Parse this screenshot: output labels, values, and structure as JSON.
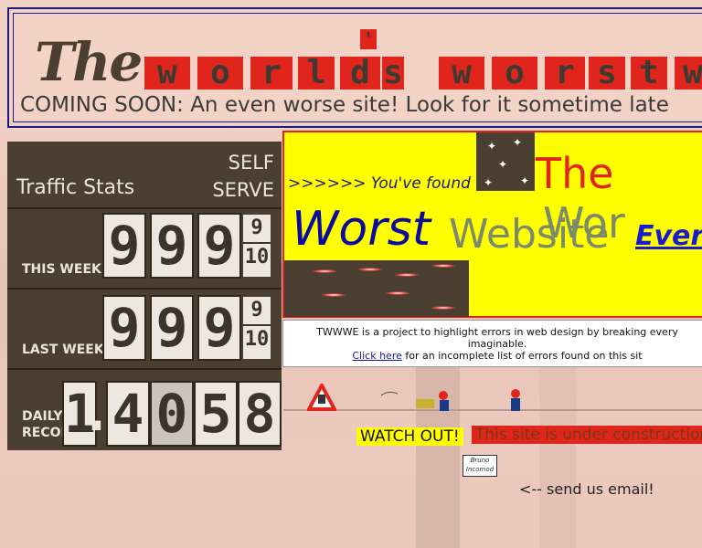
{
  "header": {
    "logo_the": "The",
    "logo_tiles": [
      "w",
      "o",
      "r",
      "l",
      "d",
      "'",
      "s",
      "w",
      "o",
      "r",
      "s",
      "t",
      "w"
    ],
    "coming_soon": "COMING SOON: An even worse site! Look for it sometime late"
  },
  "stats": {
    "title": "Traffic Stats",
    "self_serve": "SELF SERVE",
    "this_week_label": "THIS WEEK",
    "last_week_label": "LAST WEEK",
    "daily_record_label": "DAILY RECORD",
    "this_week_digits": [
      "9",
      "9",
      "9"
    ],
    "last_week_digits": [
      "9",
      "9",
      "9"
    ],
    "fraction_num": "9",
    "fraction_den": "10",
    "daily_record_digits": [
      "1",
      ".",
      "4",
      "0",
      "5",
      "8"
    ]
  },
  "banner": {
    "found": ">>>>>> You've found",
    "the": "The",
    "wor": "Wor",
    "worst": "Worst",
    "website": "Website",
    "ever": "Ever"
  },
  "description": {
    "text": "TWWWE is a project to highlight errors in web design by breaking every",
    "text2": "imaginable.",
    "link": "Click here",
    "after_link": "for an incomplete list of errors found on this sit"
  },
  "construction": {
    "watch_out": "WATCH OUT!",
    "under": "This site is under construction",
    "mailbox": "Bruno Incomod",
    "send_email": "<-- send us email!"
  },
  "colors": {
    "accent_red": "#e0261c",
    "yellow": "#ffff00",
    "brown": "#4a3f30",
    "blue": "#0a0aa0"
  }
}
